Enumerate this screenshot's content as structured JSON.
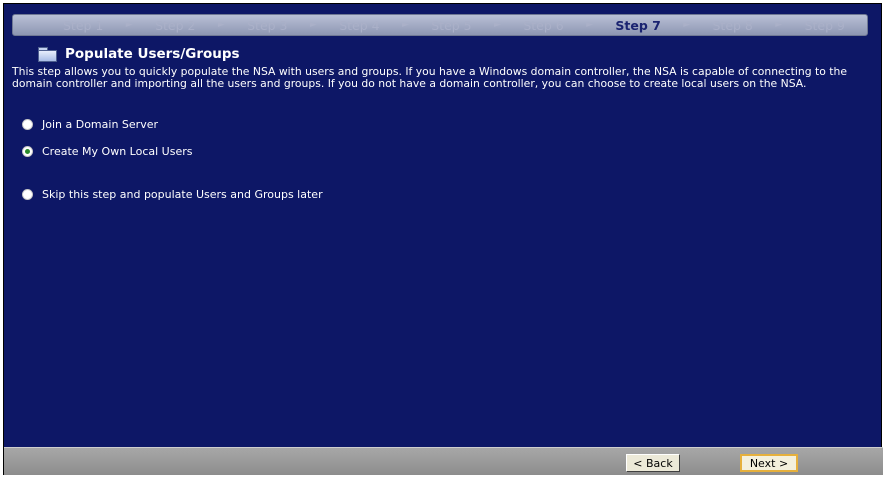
{
  "steps": [
    {
      "label": "Step 1"
    },
    {
      "label": "Step 2"
    },
    {
      "label": "Step 3"
    },
    {
      "label": "Step 4"
    },
    {
      "label": "Step 5"
    },
    {
      "label": "Step 6"
    },
    {
      "label": "Step 7",
      "active": true
    },
    {
      "label": "Step 8"
    },
    {
      "label": "Step 9"
    }
  ],
  "page": {
    "title": "Populate Users/Groups",
    "description": "This step allows you to quickly populate the NSA with users and groups. If you have a Windows domain controller, the NSA is capable of connecting to the domain controller and importing all the users and groups. If you do not have a domain controller, you can choose to create local users on the NSA."
  },
  "options": [
    {
      "label": "Join a Domain Server",
      "checked": false
    },
    {
      "label": "Create My Own Local Users",
      "checked": true
    },
    {
      "label": "Skip this step and populate Users and Groups later",
      "checked": false
    }
  ],
  "footer": {
    "back_label": "< Back",
    "next_label": "Next >"
  },
  "colors": {
    "panel_background": "#0d1766",
    "active_step": "#1a2370",
    "inactive_step": "#aab0c8",
    "selected_radio": "#2a8a2a",
    "next_button_border": "#e6b03c"
  },
  "icons": {
    "title_icon": "folder-icon",
    "step_separator": "arrow-right-icon"
  }
}
